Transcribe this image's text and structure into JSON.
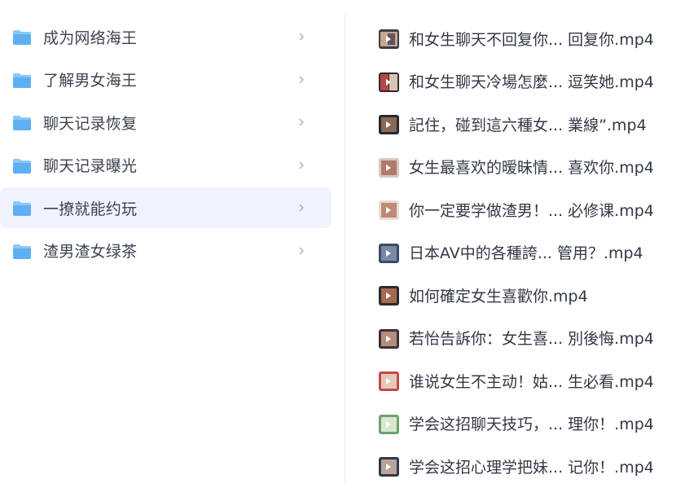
{
  "folders": [
    {
      "label": "成为网络海王",
      "selected": false
    },
    {
      "label": "了解男女海王",
      "selected": false
    },
    {
      "label": "聊天记录恢复",
      "selected": false
    },
    {
      "label": "聊天记录曝光",
      "selected": false
    },
    {
      "label": "一撩就能约玩",
      "selected": true
    },
    {
      "label": "渣男渣女绿茶",
      "selected": false
    }
  ],
  "files": [
    {
      "name": "和女生聊天不回复你... 回复你.mp4"
    },
    {
      "name": "和女生聊天冷場怎麼... 逗笑她.mp4"
    },
    {
      "name": "記住，碰到這六種女... 業線”.mp4"
    },
    {
      "name": "女生最喜欢的暧昧情... 喜欢你.mp4"
    },
    {
      "name": "你一定要学做渣男！... 必修课.mp4"
    },
    {
      "name": "日本AV中的各種誇...  管用？.mp4"
    },
    {
      "name": "如何確定女生喜歡你.mp4"
    },
    {
      "name": "若怡告訴你：女生喜... 別後悔.mp4"
    },
    {
      "name": "谁说女生不主动！姑... 生必看.mp4"
    },
    {
      "name": "学会这招聊天技巧，... 理你！.mp4"
    },
    {
      "name": "学会这招心理学把妹... 记你！.mp4"
    }
  ],
  "icons": {
    "folder": "folder-icon",
    "chevron": "chevron-right-icon",
    "thumbnail": "video-thumbnail"
  },
  "colors": {
    "selected_bg": "#f0f3fe",
    "folder_blue": "#72b8f5",
    "text": "#333a47"
  }
}
